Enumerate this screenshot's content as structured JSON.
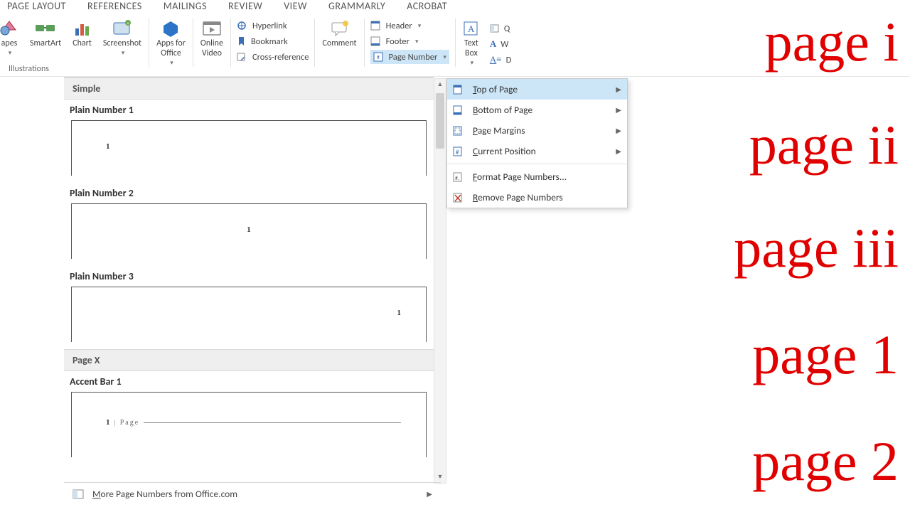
{
  "tabs": [
    "PAGE LAYOUT",
    "REFERENCES",
    "MAILINGS",
    "REVIEW",
    "VIEW",
    "GRAMMARLY",
    "ACROBAT"
  ],
  "ribbon": {
    "shapes": "apes",
    "smartart": "SmartArt",
    "chart": "Chart",
    "screenshot": "Screenshot",
    "apps": "Apps for\nOffice",
    "video": "Online\nVideo",
    "hyperlink": "Hyperlink",
    "bookmark": "Bookmark",
    "crossref": "Cross-reference",
    "comment": "Comment",
    "header": "Header",
    "footer": "Footer",
    "pagenumber": "Page Number",
    "textbox": "Text\nBox",
    "mini": {
      "q": "Q",
      "w": "W",
      "d": "D"
    },
    "group_label": "Illustrations"
  },
  "gallery": {
    "section1": "Simple",
    "items": [
      {
        "title": "Plain Number 1",
        "n": "1"
      },
      {
        "title": "Plain Number 2",
        "n": "1"
      },
      {
        "title": "Plain Number 3",
        "n": "1"
      }
    ],
    "section2": "Page X",
    "accent": {
      "title": "Accent Bar 1",
      "n": "1",
      "txt": "Page"
    },
    "more": "More Page Numbers from Office.com"
  },
  "menu": {
    "top": "Top of Page",
    "bottom": "Bottom of Page",
    "margins": "Page Margins",
    "current": "Current Position",
    "format": "Format Page Numbers...",
    "remove": "Remove Page Numbers"
  },
  "annotations": [
    "page i",
    "page ii",
    "page iii",
    "page 1",
    "page 2"
  ]
}
